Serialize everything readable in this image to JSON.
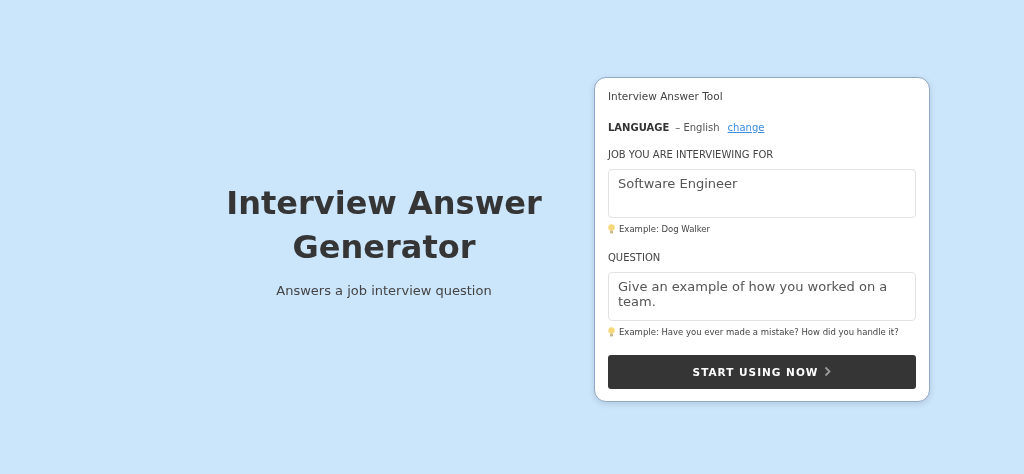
{
  "hero": {
    "title": "Interview Answer Generator",
    "subtitle": "Answers a job interview question"
  },
  "card": {
    "title": "Interview Answer Tool",
    "language": {
      "label": "LANGUAGE",
      "value": "– English",
      "link": "change"
    },
    "fields": [
      {
        "label": "JOB YOU ARE INTERVIEWING FOR",
        "value": "Software Engineer",
        "hint": "Example: Dog Walker"
      },
      {
        "label": "QUESTION",
        "value": "Give an example of how you worked on a team.",
        "hint": "Example: Have you ever made a mistake? How did you handle it?"
      }
    ],
    "button": "START USING NOW"
  }
}
